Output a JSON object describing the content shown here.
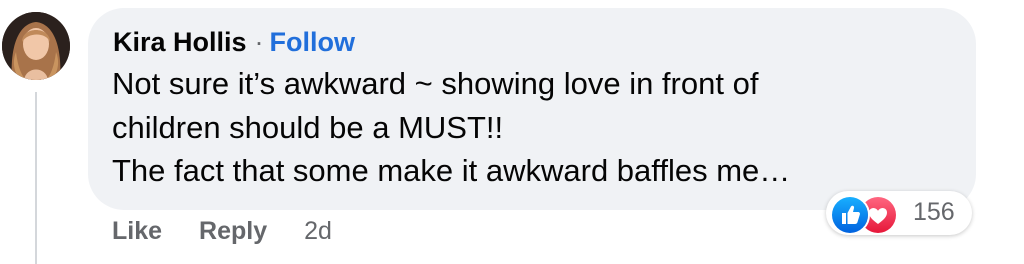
{
  "comment": {
    "author": "Kira Hollis",
    "separator": "·",
    "follow_label": "Follow",
    "text_lines": [
      "Not sure it’s awkward ~ showing love in front of",
      "children should be a MUST!!",
      "The fact that some make it awkward baffles me…"
    ],
    "actions": {
      "like_label": "Like",
      "reply_label": "Reply",
      "timestamp": "2d"
    },
    "reactions": {
      "icons": [
        "like-icon",
        "love-icon"
      ],
      "count": "156"
    }
  },
  "colors": {
    "bubble_bg": "#f0f2f5",
    "follow": "#216fdb",
    "muted": "#65676b",
    "like_blue": "#1877f2",
    "love_red": "#f02849"
  }
}
